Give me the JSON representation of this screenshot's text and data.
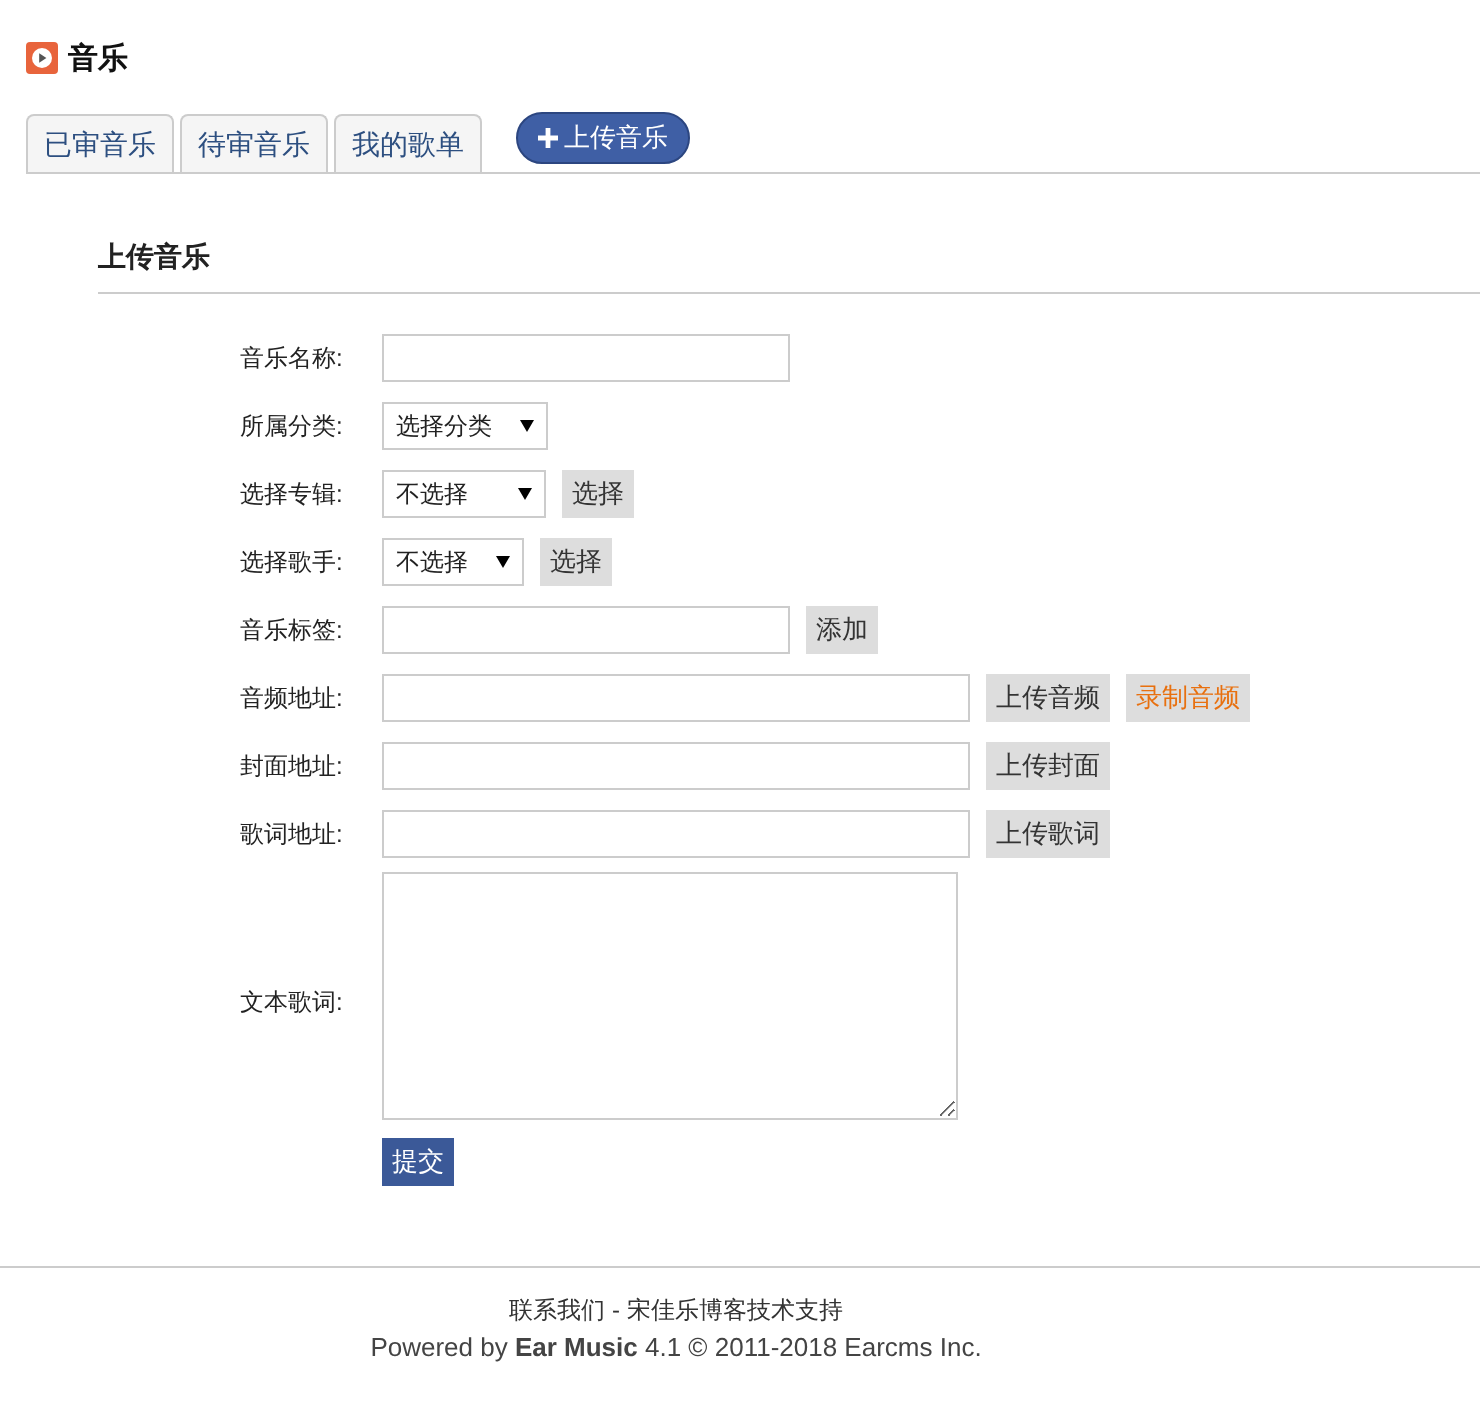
{
  "header": {
    "title": "音乐"
  },
  "tabs": [
    {
      "label": "已审音乐",
      "selected": false
    },
    {
      "label": "待审音乐",
      "selected": false
    },
    {
      "label": "我的歌单",
      "selected": false
    }
  ],
  "upload_button": {
    "label": "上传音乐"
  },
  "section": {
    "title": "上传音乐"
  },
  "form_rows": [
    {
      "label": "音乐名称:",
      "kind": "text",
      "buttons": []
    },
    {
      "label": "所属分类:",
      "kind": "select",
      "value": "选择分类",
      "buttons": []
    },
    {
      "label": "选择专辑:",
      "kind": "select",
      "value": "不选择",
      "buttons": [
        {
          "label": "选择",
          "kind": "plain"
        }
      ]
    },
    {
      "label": "选择歌手:",
      "kind": "select",
      "value": "不选择",
      "buttons": [
        {
          "label": "选择",
          "kind": "plain"
        }
      ]
    },
    {
      "label": "音乐标签:",
      "kind": "text",
      "buttons": [
        {
          "label": "添加",
          "kind": "plain"
        }
      ]
    },
    {
      "label": "音频地址:",
      "kind": "text",
      "buttons": [
        {
          "label": "上传音频",
          "kind": "plain"
        },
        {
          "label": "录制音频",
          "kind": "accent"
        }
      ]
    },
    {
      "label": "封面地址:",
      "kind": "text",
      "buttons": [
        {
          "label": "上传封面",
          "kind": "plain"
        }
      ]
    },
    {
      "label": "歌词地址:",
      "kind": "text",
      "buttons": [
        {
          "label": "上传歌词",
          "kind": "plain"
        }
      ]
    },
    {
      "label": "文本歌词:",
      "kind": "textarea",
      "buttons": []
    }
  ],
  "submit": {
    "label": "提交"
  },
  "footer": {
    "contact": "联系我们 - 宋佳乐博客技术支持",
    "powered": "Powered by **Ear Music** 4.1 © 2011-2018 Earcms Inc."
  }
}
